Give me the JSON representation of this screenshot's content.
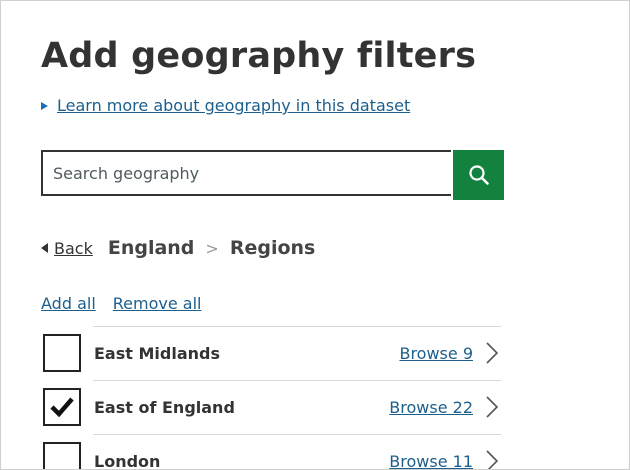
{
  "page": {
    "title": "Add geography filters",
    "details_link": "Learn more about geography in this dataset"
  },
  "search": {
    "placeholder": "Search geography",
    "value": "",
    "button_icon": "search-icon"
  },
  "breadcrumb": {
    "back_label": "Back",
    "items": [
      "England",
      "Regions"
    ],
    "separator": ">"
  },
  "bulk_actions": {
    "add_all": "Add all",
    "remove_all": "Remove all"
  },
  "regions": [
    {
      "label": "East Midlands",
      "browse": "Browse 9",
      "checked": false
    },
    {
      "label": "East of England",
      "browse": "Browse 22",
      "checked": true
    },
    {
      "label": "London",
      "browse": "Browse 11",
      "checked": false
    }
  ],
  "colors": {
    "link": "#1d5f8c",
    "search_button": "#12823e",
    "text": "#333333"
  }
}
